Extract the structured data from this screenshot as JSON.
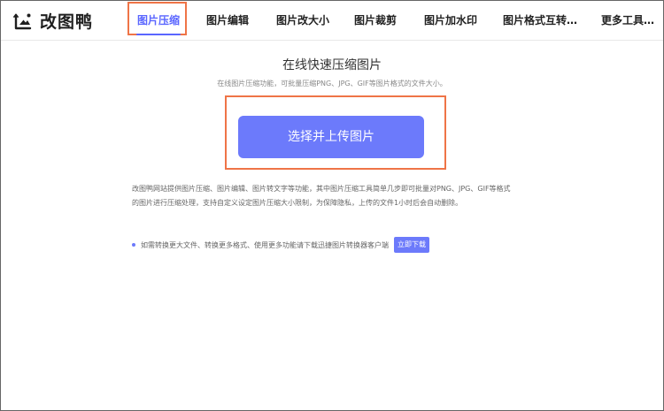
{
  "brand": {
    "name": "改图鸭"
  },
  "nav": {
    "items": [
      {
        "label": "图片压缩"
      },
      {
        "label": "图片编辑"
      },
      {
        "label": "图片改大小"
      },
      {
        "label": "图片裁剪"
      },
      {
        "label": "图片加水印"
      },
      {
        "label": "图片格式互转…"
      },
      {
        "label": "更多工具…"
      }
    ]
  },
  "main": {
    "title": "在线快速压缩图片",
    "subtitle": "在线图片压缩功能，可批量压缩PNG、JPG、GIF等图片格式的文件大小。",
    "upload_label": "选择并上传图片",
    "description": [
      "改图鸭网站提供图片压缩、图片编辑、图片转文字等功能，其中图片压缩工具简单几步即可批量对PNG、JPG、GIF等格式",
      "的图片进行压缩处理，支持自定义设定图片压缩大小限制，为保障隐私，上传的文件1小时后会自动删除。"
    ],
    "notice": "如需转换更大文件、转换更多格式、使用更多功能请下载迅捷图片转换器客户端",
    "download_label": "立即下载"
  },
  "colors": {
    "accent": "#6c7afb",
    "active_nav": "#5a66ff",
    "highlight_border": "#ef7447"
  }
}
